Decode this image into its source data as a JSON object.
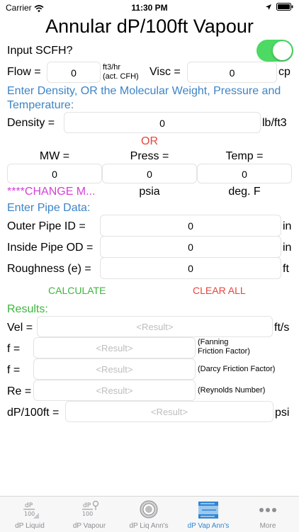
{
  "status": {
    "carrier": "Carrier",
    "time": "11:30 PM"
  },
  "title": "Annular dP/100ft Vapour",
  "input_scfh": {
    "label": "Input SCFH?",
    "on": true
  },
  "flow": {
    "label": "Flow =",
    "value": "0",
    "unit": "ft3/hr\n(act. CFH)"
  },
  "visc": {
    "label": "Visc =",
    "value": "0",
    "unit": "cp"
  },
  "density_hint": "Enter Density, OR the Molecular Weight, Pressure and Temperature:",
  "density": {
    "label": "Density =",
    "value": "0",
    "unit": "lb/ft3"
  },
  "or_label": "OR",
  "mw": {
    "label": "MW =",
    "value": "0",
    "unit": "****CHANGE M..."
  },
  "press": {
    "label": "Press =",
    "value": "0",
    "unit": "psia"
  },
  "temp": {
    "label": "Temp =",
    "value": "0",
    "unit": "deg. F"
  },
  "pipe_hint": "Enter Pipe Data:",
  "outer_id": {
    "label": "Outer Pipe ID =",
    "value": "0",
    "unit": "in"
  },
  "inside_od": {
    "label": "Inside Pipe OD =",
    "value": "0",
    "unit": "in"
  },
  "roughness": {
    "label": "Roughness (e) =",
    "value": "0",
    "unit": "ft"
  },
  "buttons": {
    "calculate": "CALCULATE",
    "clear": "CLEAR ALL"
  },
  "results_label": "Results:",
  "results": {
    "vel": {
      "label": "Vel =",
      "placeholder": "<Result>",
      "unit": "ft/s"
    },
    "f_fanning": {
      "label": "f =",
      "placeholder": "<Result>",
      "unit": "(Fanning\nFriction Factor)"
    },
    "f_darcy": {
      "label": "f =",
      "placeholder": "<Result>",
      "unit": "(Darcy Friction Factor)"
    },
    "re": {
      "label": "Re =",
      "placeholder": "<Result>",
      "unit": "(Reynolds Number)"
    },
    "dp": {
      "label": "dP/100ft =",
      "placeholder": "<Result>",
      "unit": "psi"
    }
  },
  "tabs": [
    {
      "label": "dP Liquid",
      "icon": "dp-liquid-icon",
      "active": false
    },
    {
      "label": "dP Vapour",
      "icon": "dp-vapour-icon",
      "active": false
    },
    {
      "label": "dP Liq Ann's",
      "icon": "dp-liquid-annular-icon",
      "active": false
    },
    {
      "label": "dP Vap Ann's",
      "icon": "dp-vapour-annular-icon",
      "active": true
    },
    {
      "label": "More",
      "icon": "more-icon",
      "active": false
    }
  ],
  "colors": {
    "accent_blue": "#3d84c6",
    "red": "#e8453c",
    "green": "#3db53d",
    "magenta": "#d63fd6",
    "toggle_on": "#4cd964",
    "tab_active": "#2f86d4"
  }
}
